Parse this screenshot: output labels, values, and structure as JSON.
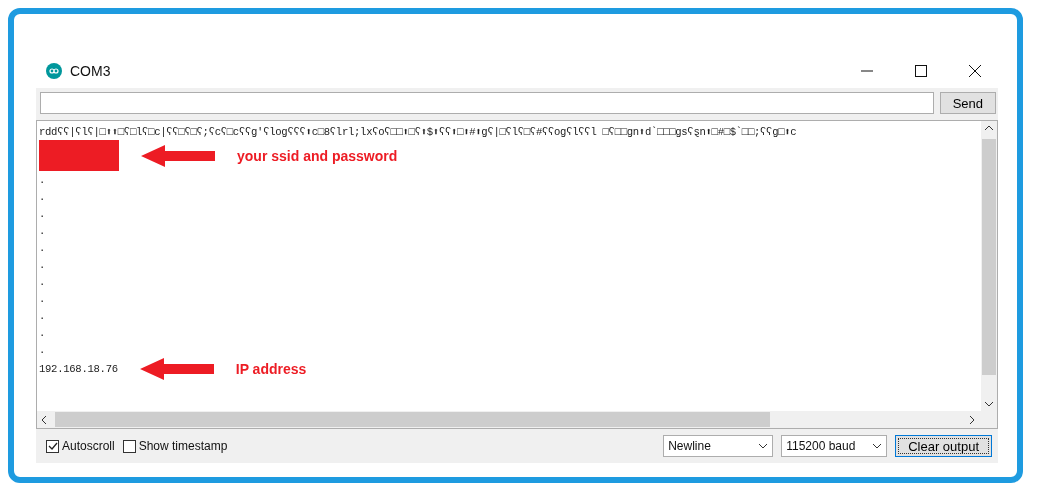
{
  "window": {
    "title": "COM3"
  },
  "send_button": "Send",
  "output": {
    "lines": [
      {
        "kind": "text",
        "text": "rddʕʕ|ʕlʕ|□⬆⬆□ʕ□lʕ□c|ʕʕ□ʕ□ʕ;ʕcʕ□cʕʕg'ʕlogʕʕʕ⬆c□8ʕlrl;lxʕoʕ□□⬆□ʕ⬆$⬆ʕʕ⬆□⬆#⬆gʕ|□ʕlʕ□ʕ#ʕʕogʕlʕʕl □ʕ□□gn⬆d`□□□gsʕȿn⬆□#□$`□□;ʕʕg□⬆c"
      },
      {
        "kind": "redacted",
        "annotation": "your ssid and password"
      },
      {
        "kind": "text",
        "text": "."
      },
      {
        "kind": "text",
        "text": "."
      },
      {
        "kind": "text",
        "text": "."
      },
      {
        "kind": "text",
        "text": "."
      },
      {
        "kind": "text",
        "text": "."
      },
      {
        "kind": "text",
        "text": "."
      },
      {
        "kind": "text",
        "text": "."
      },
      {
        "kind": "text",
        "text": "."
      },
      {
        "kind": "text",
        "text": "."
      },
      {
        "kind": "text",
        "text": "."
      },
      {
        "kind": "text",
        "text": "."
      },
      {
        "kind": "text",
        "text": "192.168.18.76",
        "annotation": "IP address"
      }
    ]
  },
  "footer": {
    "checkboxes": [
      {
        "label": "Autoscroll",
        "checked": true
      },
      {
        "label": "Show timestamp",
        "checked": false
      }
    ],
    "line_ending": "Newline",
    "baud": "115200 baud",
    "clear_button": "Clear output"
  }
}
